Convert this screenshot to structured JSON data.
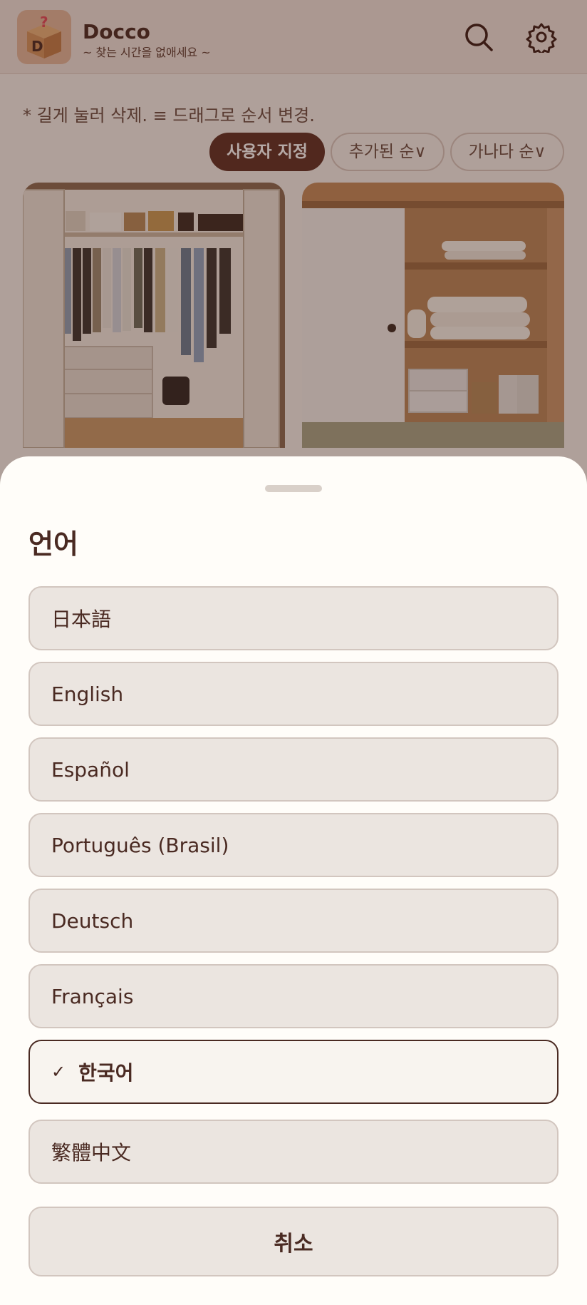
{
  "app": {
    "name": "Docco",
    "tagline": "~ 찾는 시간을 없애세요 ~",
    "hint": "* 길게 눌러 삭제. ≡ 드래그로 순서 변경.",
    "sort_options": [
      {
        "label": "사용자 지정",
        "active": true
      },
      {
        "label": "추가된 순∨",
        "active": false
      },
      {
        "label": "가나다 순∨",
        "active": false
      }
    ],
    "icons": [
      "app-logo-icon",
      "search-icon",
      "gear-icon"
    ]
  },
  "sheet": {
    "title": "언어",
    "options": [
      {
        "label": "日本語",
        "selected": false
      },
      {
        "label": "English",
        "selected": false
      },
      {
        "label": "Español",
        "selected": false
      },
      {
        "label": "Português (Brasil)",
        "selected": false
      },
      {
        "label": "Deutsch",
        "selected": false
      },
      {
        "label": "Français",
        "selected": false
      },
      {
        "label": "한국어",
        "selected": true,
        "check": "✓"
      },
      {
        "label": "繁體中文",
        "selected": false
      }
    ],
    "cancel_label": "취소"
  },
  "colors": {
    "accent": "#5e2f24",
    "text": "#4a2a22",
    "sheet_bg": "#fffdf9",
    "option_bg": "#ebe5e0"
  }
}
